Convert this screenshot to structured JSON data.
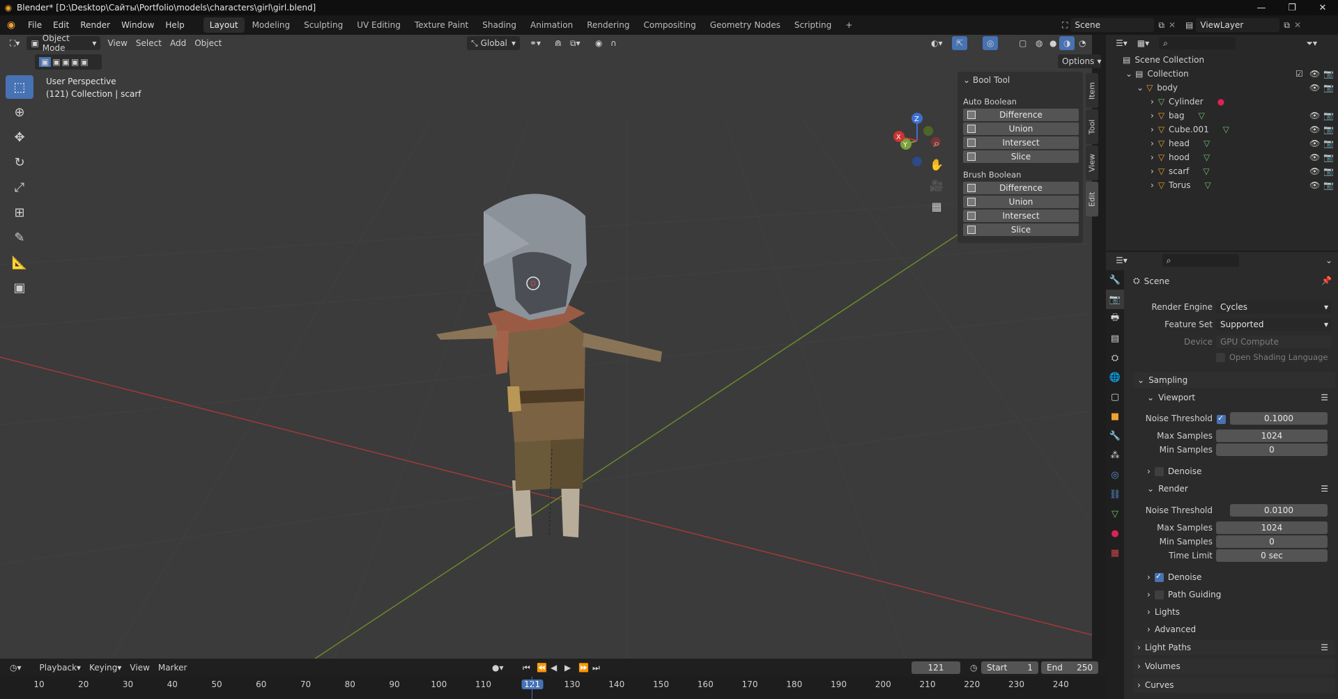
{
  "titlebar": {
    "text": "Blender* [D:\\Desktop\\Сайты\\Portfolio\\models\\characters\\girl\\girl.blend]",
    "min": "—",
    "restore": "❐",
    "close": "✕"
  },
  "menus": [
    "File",
    "Edit",
    "Render",
    "Window",
    "Help"
  ],
  "workspaces": [
    "Layout",
    "Modeling",
    "Sculpting",
    "UV Editing",
    "Texture Paint",
    "Shading",
    "Animation",
    "Rendering",
    "Compositing",
    "Geometry Nodes",
    "Scripting",
    "+"
  ],
  "active_workspace": "Layout",
  "scene": {
    "label": "Scene",
    "viewlayer": "ViewLayer"
  },
  "vp_header": {
    "mode": "Object Mode",
    "view": "View",
    "select": "Select",
    "add": "Add",
    "object": "Object",
    "orientation": "Global",
    "options": "Options"
  },
  "viewport": {
    "perspective": "User Perspective",
    "collection": "(121) Collection | scarf"
  },
  "gizmo": {
    "x": "X",
    "y": "Y",
    "z": "Z"
  },
  "toolbar_icons": [
    "select-box-icon",
    "cursor-icon",
    "move-icon",
    "rotate-icon",
    "scale-icon",
    "transform-icon",
    "annotate-icon",
    "measure-icon",
    "add-cube-icon"
  ],
  "side_tabs": [
    "Item",
    "Tool",
    "View",
    "Edit"
  ],
  "booltool": {
    "title": "Bool Tool",
    "auto": "Auto Boolean",
    "brush": "Brush Boolean",
    "auto_ops": [
      "Difference",
      "Union",
      "Intersect",
      "Slice"
    ],
    "brush_ops": [
      "Difference",
      "Union",
      "Intersect",
      "Slice"
    ]
  },
  "outliner": {
    "scene_collection": "Scene Collection",
    "collection": "Collection",
    "body": "body",
    "children": [
      "Cylinder",
      "bag",
      "Cube.001",
      "head",
      "hood",
      "scarf",
      "Torus"
    ]
  },
  "properties": {
    "context": "Scene",
    "render_engine_label": "Render Engine",
    "render_engine": "Cycles",
    "feature_set_label": "Feature Set",
    "feature_set": "Supported",
    "device_label": "Device",
    "device": "GPU Compute",
    "osl": "Open Shading Language",
    "sampling": "Sampling",
    "viewport": {
      "title": "Viewport",
      "noise_label": "Noise Threshold",
      "noise": "0.1000",
      "max_label": "Max Samples",
      "max": "1024",
      "min_label": "Min Samples",
      "min": "0",
      "denoise": "Denoise"
    },
    "render": {
      "title": "Render",
      "noise_label": "Noise Threshold",
      "noise": "0.0100",
      "max_label": "Max Samples",
      "max": "1024",
      "min_label": "Min Samples",
      "min": "0",
      "time_label": "Time Limit",
      "time": "0 sec",
      "denoise": "Denoise"
    },
    "path_guiding": "Path Guiding",
    "lights": "Lights",
    "advanced": "Advanced",
    "light_paths": "Light Paths",
    "volumes": "Volumes",
    "curves": "Curves"
  },
  "timeline": {
    "playback": "Playback",
    "keying": "Keying",
    "view": "View",
    "marker": "Marker",
    "current": "121",
    "start_label": "Start",
    "start": "1",
    "end_label": "End",
    "end": "250",
    "ticks": [
      "10",
      "20",
      "30",
      "40",
      "50",
      "60",
      "70",
      "80",
      "90",
      "100",
      "110",
      "121",
      "130",
      "140",
      "150",
      "160",
      "170",
      "180",
      "190",
      "200",
      "210",
      "220",
      "230",
      "240"
    ]
  }
}
